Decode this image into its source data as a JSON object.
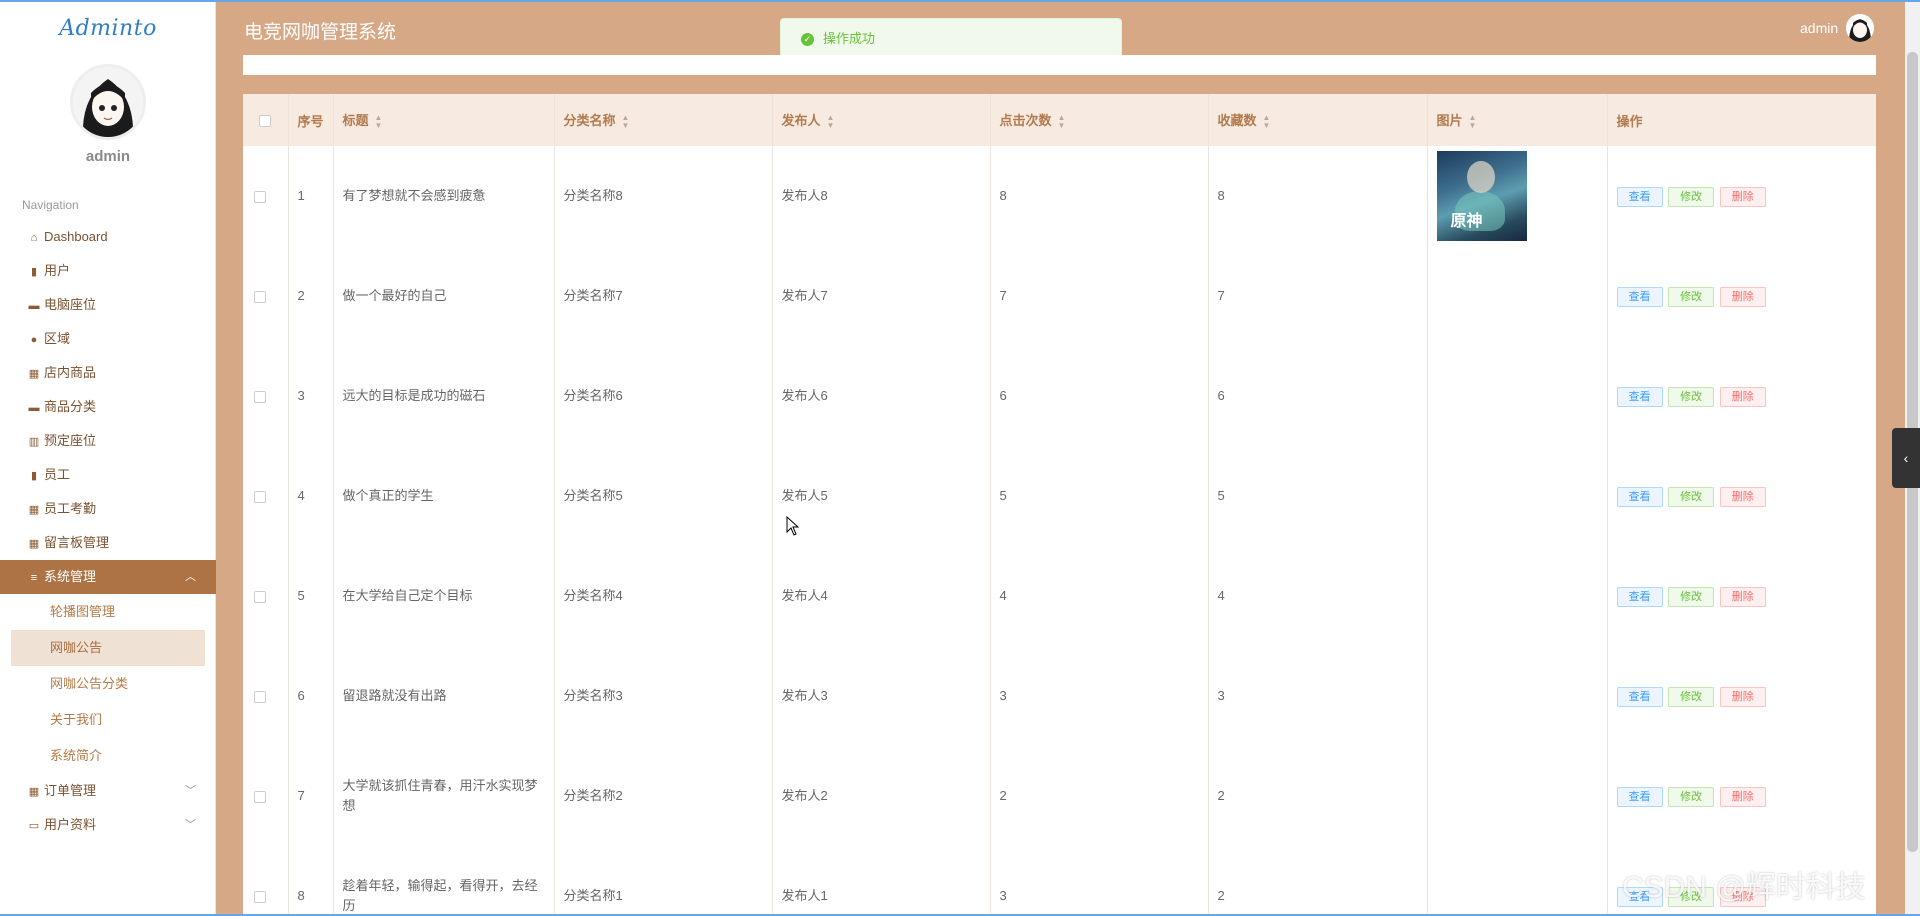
{
  "app": {
    "logo": "Adminto",
    "title": "电竞网咖管理系统",
    "user": "admin"
  },
  "toast": {
    "message": "操作成功"
  },
  "sidebar": {
    "username": "admin",
    "heading": "Navigation",
    "items": [
      {
        "label": "Dashboard",
        "icon": "home-icon"
      },
      {
        "label": "用户",
        "icon": "clipboard-icon"
      },
      {
        "label": "电脑座位",
        "icon": "monitor-icon"
      },
      {
        "label": "区域",
        "icon": "user-icon"
      },
      {
        "label": "店内商品",
        "icon": "grid-icon"
      },
      {
        "label": "商品分类",
        "icon": "chat-icon"
      },
      {
        "label": "预定座位",
        "icon": "bar-chart-icon"
      },
      {
        "label": "员工",
        "icon": "clipboard-icon"
      },
      {
        "label": "员工考勤",
        "icon": "grid-icon"
      },
      {
        "label": "留言板管理",
        "icon": "grid-icon"
      }
    ],
    "system_menu": {
      "label": "系统管理",
      "sub_items": [
        "轮播图管理",
        "网咖公告",
        "网咖公告分类",
        "关于我们",
        "系统简介"
      ],
      "active_sub": "网咖公告"
    },
    "bottom_items": [
      {
        "label": "订单管理",
        "icon": "grid-icon"
      },
      {
        "label": "用户资料",
        "icon": "card-icon"
      }
    ]
  },
  "table": {
    "headers": {
      "index": "序号",
      "title": "标题",
      "category": "分类名称",
      "publisher": "发布人",
      "clicks": "点击次数",
      "favorites": "收藏数",
      "image": "图片",
      "actions": "操作"
    },
    "image_text": "原神",
    "buttons": {
      "view": "查看",
      "edit": "修改",
      "delete": "删除"
    },
    "rows": [
      {
        "index": "1",
        "title": "有了梦想就不会感到疲惫",
        "category": "分类名称8",
        "publisher": "发布人8",
        "clicks": "8",
        "favorites": "8",
        "has_image": true
      },
      {
        "index": "2",
        "title": "做一个最好的自己",
        "category": "分类名称7",
        "publisher": "发布人7",
        "clicks": "7",
        "favorites": "7"
      },
      {
        "index": "3",
        "title": "远大的目标是成功的磁石",
        "category": "分类名称6",
        "publisher": "发布人6",
        "clicks": "6",
        "favorites": "6"
      },
      {
        "index": "4",
        "title": "做个真正的学生",
        "category": "分类名称5",
        "publisher": "发布人5",
        "clicks": "5",
        "favorites": "5"
      },
      {
        "index": "5",
        "title": "在大学给自己定个目标",
        "category": "分类名称4",
        "publisher": "发布人4",
        "clicks": "4",
        "favorites": "4"
      },
      {
        "index": "6",
        "title": "留退路就没有出路",
        "category": "分类名称3",
        "publisher": "发布人3",
        "clicks": "3",
        "favorites": "3"
      },
      {
        "index": "7",
        "title": "大学就该抓住青春，用汗水实现梦想",
        "category": "分类名称2",
        "publisher": "发布人2",
        "clicks": "2",
        "favorites": "2"
      },
      {
        "index": "8",
        "title": "趁着年轻，输得起，看得开，去经历",
        "category": "分类名称1",
        "publisher": "发布人1",
        "clicks": "3",
        "favorites": "2"
      }
    ]
  },
  "watermark": "CSDN @辉时科技",
  "colors": {
    "header_bg": "#d7a886",
    "sidebar_active": "#ad7345",
    "toast_green": "#67c23a"
  }
}
